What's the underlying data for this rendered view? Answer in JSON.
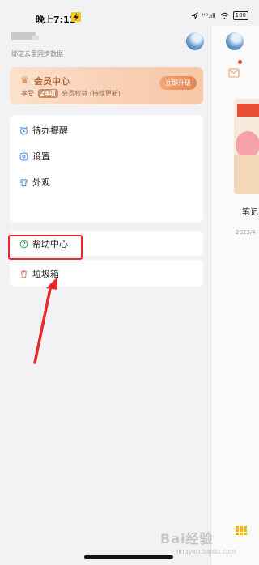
{
  "status_bar": {
    "time": "晚上7:11",
    "signal": "ᴴᴰ.ıll",
    "battery": "100"
  },
  "drawer": {
    "sync_hint": "绑定云盘同步数据",
    "vip": {
      "title": "会员中心",
      "desc_prefix": "享受",
      "desc_days": "24项",
      "desc_suffix": "会员权益 (持续更新)",
      "upgrade": "立即升级"
    },
    "group1": [
      {
        "label": "待办提醒",
        "icon": "alarm-clock-icon"
      },
      {
        "label": "设置",
        "icon": "settings-icon"
      },
      {
        "label": "外观",
        "icon": "tshirt-icon"
      }
    ],
    "help": {
      "label": "帮助中心",
      "icon": "help-icon"
    },
    "trash": {
      "label": "垃圾箱",
      "icon": "trash-icon"
    }
  },
  "right_panel": {
    "note_title": "笔记",
    "note_date": "2023/4"
  },
  "watermark": {
    "text": "Bai经验",
    "sub": "jingyan.baidu.com"
  },
  "colors": {
    "highlight": "#e42a2a",
    "accent": "#e4834f"
  }
}
